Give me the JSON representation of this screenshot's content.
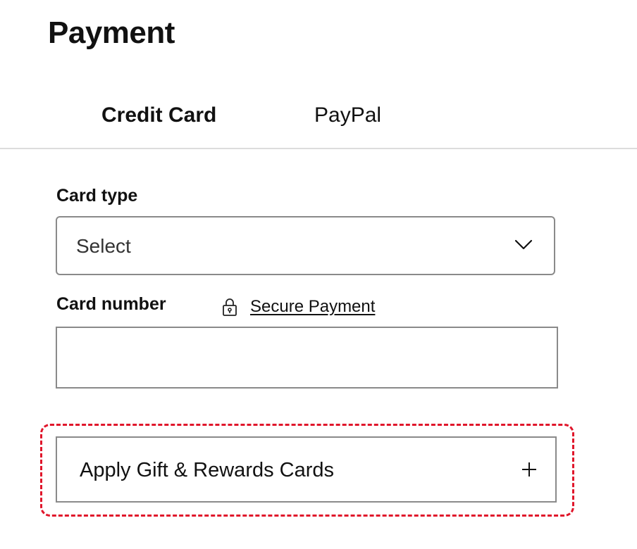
{
  "header": {
    "title": "Payment"
  },
  "tabs": [
    {
      "label": "Credit Card",
      "active": true
    },
    {
      "label": "PayPal",
      "active": false
    }
  ],
  "form": {
    "card_type": {
      "label": "Card type",
      "value": "Select",
      "icon": "chevron-down-icon"
    },
    "card_number": {
      "label": "Card number",
      "value": "",
      "placeholder": ""
    },
    "secure_payment": {
      "label": "Secure Payment",
      "icon": "lock-icon"
    }
  },
  "gift_cards": {
    "label": "Apply Gift & Rewards Cards",
    "icon": "plus-icon"
  },
  "colors": {
    "highlight": "#e0162b",
    "border": "#8a8a8a",
    "divider": "#dcdcdc"
  }
}
